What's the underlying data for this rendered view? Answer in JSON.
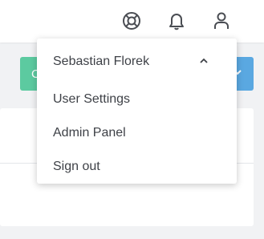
{
  "header": {
    "icons": [
      "lifebuoy-icon",
      "bell-icon",
      "user-icon"
    ]
  },
  "background": {
    "green_button_initial": "C",
    "accent_green": "#5ccaa0",
    "accent_blue": "#5aa8e1"
  },
  "user_menu": {
    "user_name": "Sebastian Florek",
    "items": [
      {
        "label": "User Settings"
      },
      {
        "label": "Admin Panel"
      },
      {
        "label": "Sign out"
      }
    ]
  }
}
